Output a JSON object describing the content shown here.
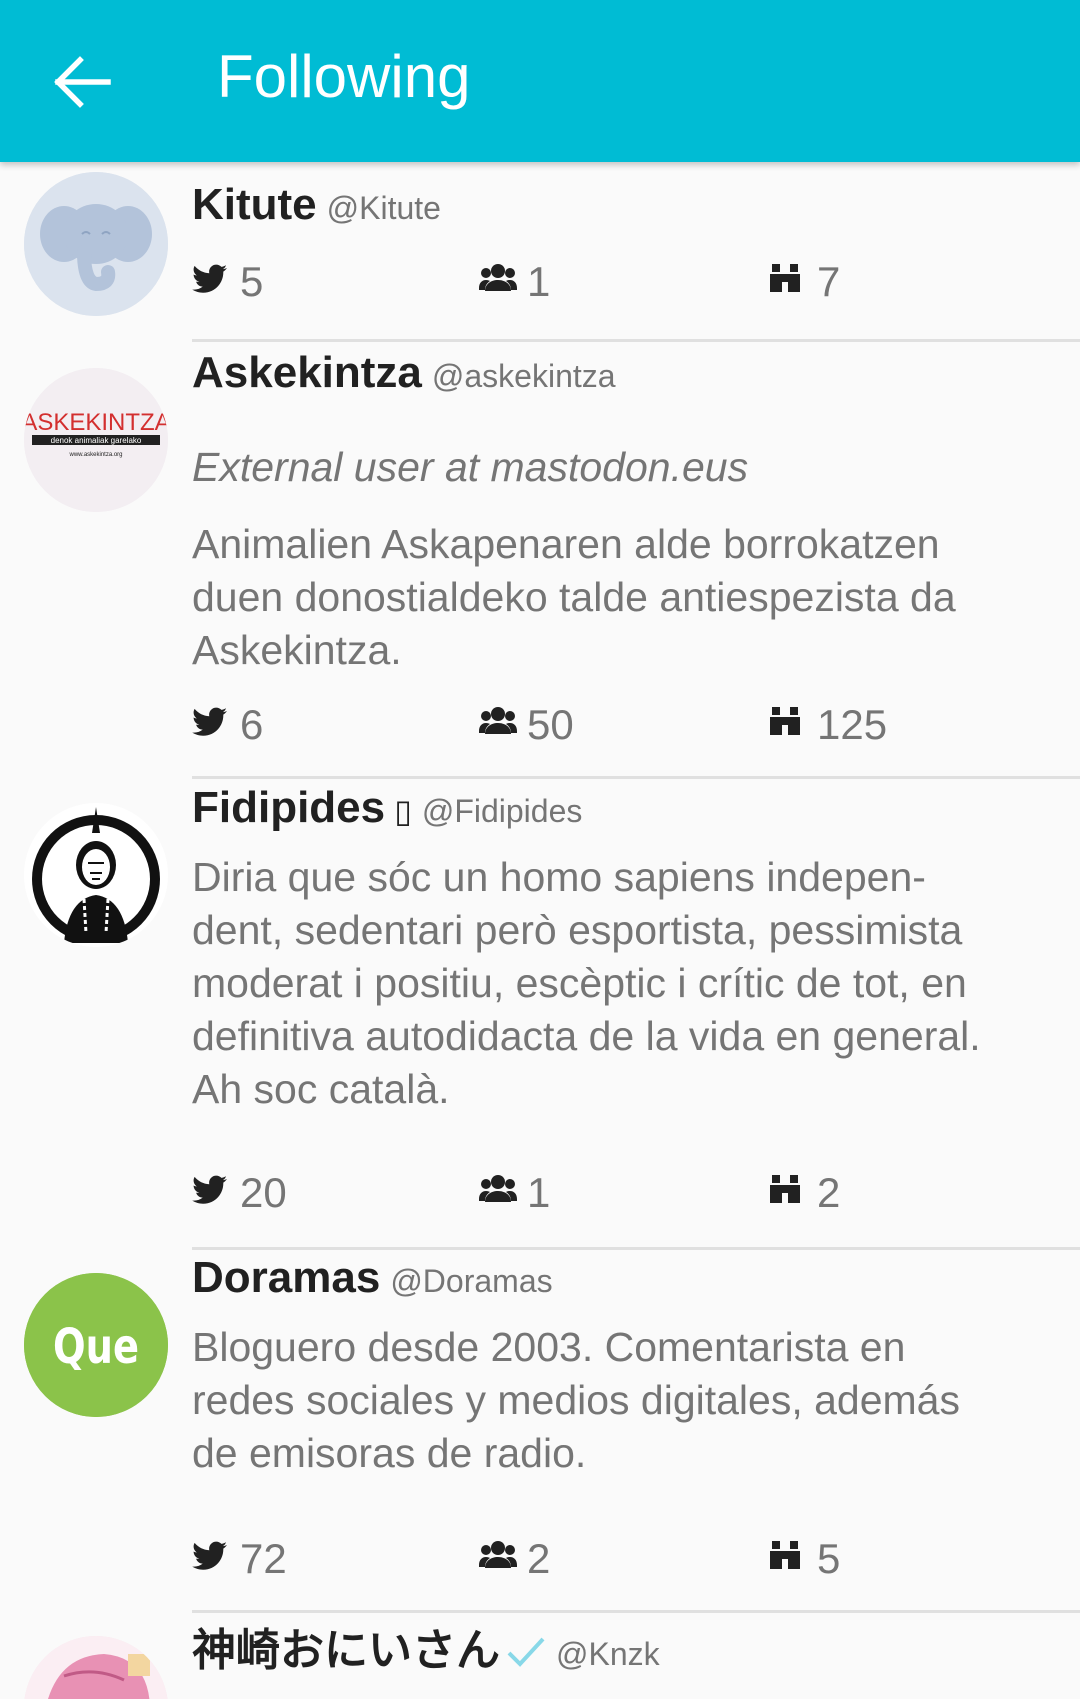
{
  "appbar": {
    "title": "Following",
    "back_icon": "arrow-left-icon",
    "color": "#00bcd4"
  },
  "accounts": [
    {
      "display_name": "Kitute",
      "username": "@Kitute",
      "avatar": "elephant-placeholder",
      "stats": {
        "posts": "5",
        "followers": "1",
        "following": "7"
      }
    },
    {
      "display_name": "Askekintza",
      "username": "@askekintza",
      "note": "External user at mastodon.eus",
      "bio": "Animalien Askapenaren alde borrokatzen\nduen donostialdeko talde antiespezista da\nAskekintza.",
      "avatar": "askekintza-logo",
      "avatar_text": "ASKEKINTZA",
      "avatar_subtext": "denok animaliak garelako",
      "avatar_url": "www.askekintza.org",
      "stats": {
        "posts": "6",
        "followers": "50",
        "following": "125"
      }
    },
    {
      "display_name": "Fidipides",
      "name_suffix": "▯",
      "username": "@Fidipides",
      "bio": "Diria que sóc un homo sapiens indepen-\ndent, sedentari però esportista, pessimista\nmoderat i positiu, escèptic i crític de tot, en\ndefinitiva autodidacta de la vida en general.\nAh soc català.",
      "avatar": "native-chief-portrait",
      "stats": {
        "posts": "20",
        "followers": "1",
        "following": "2"
      }
    },
    {
      "display_name": "Doramas",
      "username": "@Doramas",
      "bio": "Bloguero desde 2003. Comentarista en\nredes sociales y medios digitales, además\nde emisoras de radio.",
      "avatar": "que-logo",
      "avatar_text": "Que",
      "stats": {
        "posts": "72",
        "followers": "2",
        "following": "5"
      }
    },
    {
      "display_name": "神崎おにいさん",
      "username": "@Knzk",
      "verified_icon": "check-icon",
      "avatar": "anime-portrait"
    }
  ],
  "icons": {
    "posts": "bird-icon",
    "followers": "group-icon",
    "following": "binoculars-icon"
  },
  "colors": {
    "secondary_text": "#757575",
    "primary_text": "#212121",
    "divider": "#e0e0e0",
    "que_green": "#8bc34a",
    "askekintza_red": "#d32f2f"
  }
}
